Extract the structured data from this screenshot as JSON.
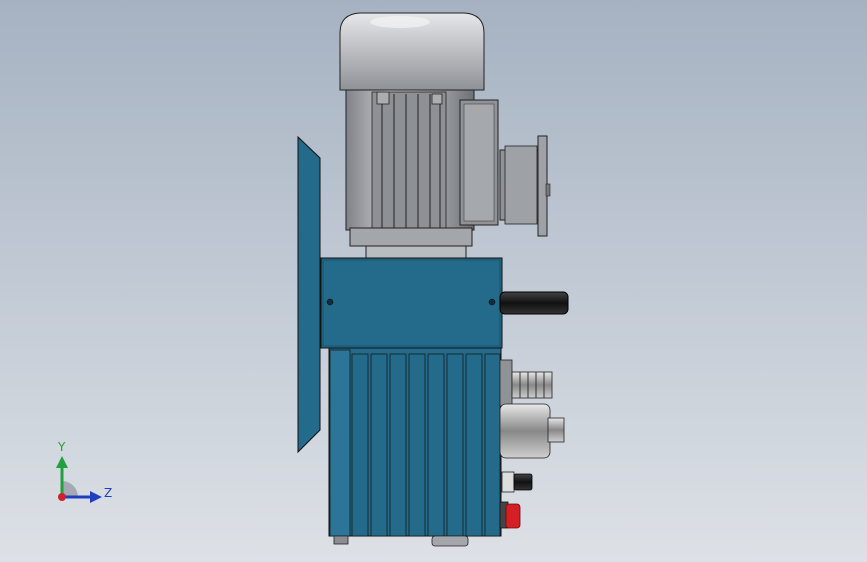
{
  "colors": {
    "background_top": "#a6b2c2",
    "background_bottom": "#dde1e6",
    "housing": "#246a8a",
    "housing_dark": "#1a4f68",
    "motor": "#9a9da3",
    "motor_light": "#c8cace",
    "axis_x": "#d0202a",
    "axis_y": "#22a040",
    "axis_z": "#1f3fbf"
  },
  "triad": {
    "y_label": "Y",
    "z_label": "Z"
  },
  "icons": [
    "motor-cap-icon",
    "fan-cover-icon",
    "terminal-box-icon",
    "flange-icon",
    "handle-icon",
    "red-button-icon",
    "knob-icon"
  ]
}
